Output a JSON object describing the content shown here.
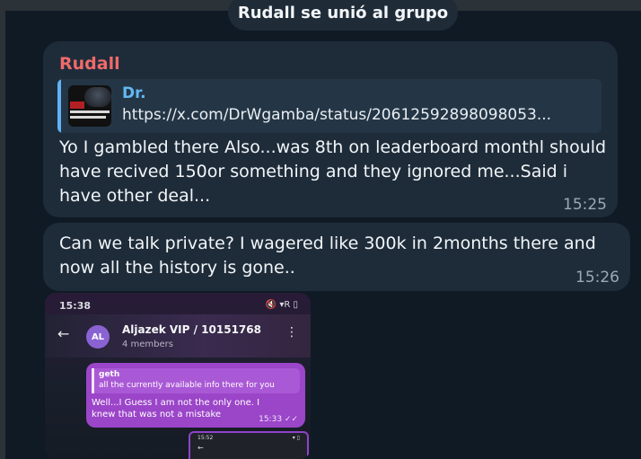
{
  "service_message": "Rudall se unió al grupo",
  "message1": {
    "sender": "Rudall",
    "preview_title": "Dr.",
    "preview_url": "https://x.com/DrWgamba/status/20612592898098053...",
    "text": "Yo I gambled there Also...was 8th on leaderboard monthl should have recived 150or something and they ignored me...Said i have other deal...",
    "time": "15:25"
  },
  "message2": {
    "text": "Can we talk private? I wagered like 300k in 2months there and now all the history is gone..",
    "time": "15:26"
  },
  "screenshot": {
    "status_time": "15:38",
    "status_icons": "🔇 ▾R ▯",
    "back_icon": "←",
    "avatar": "AL",
    "group_name": "Aljazek VIP / 10151768",
    "members": "4 members",
    "more_icon": "⋮",
    "reply_name": "geth",
    "reply_text": "all the currently available info there for you",
    "message_text": "Well...I Guess I am not the only one. I knew that was not a mistake",
    "message_time": "15:33 ✓✓",
    "mini_time": "15:52",
    "mini_icons": "▾ ▯",
    "mini_back": "←"
  },
  "colors": {
    "background": "#0f1a25",
    "bubble": "#1e2c3a",
    "sender": "#ef6a6a",
    "link_title": "#63b8f3",
    "screenshot_bubble": "#9b45c9"
  },
  "icons": {
    "back": "back-arrow-icon",
    "more": "more-vertical-icon",
    "checks": "double-check-icon"
  }
}
